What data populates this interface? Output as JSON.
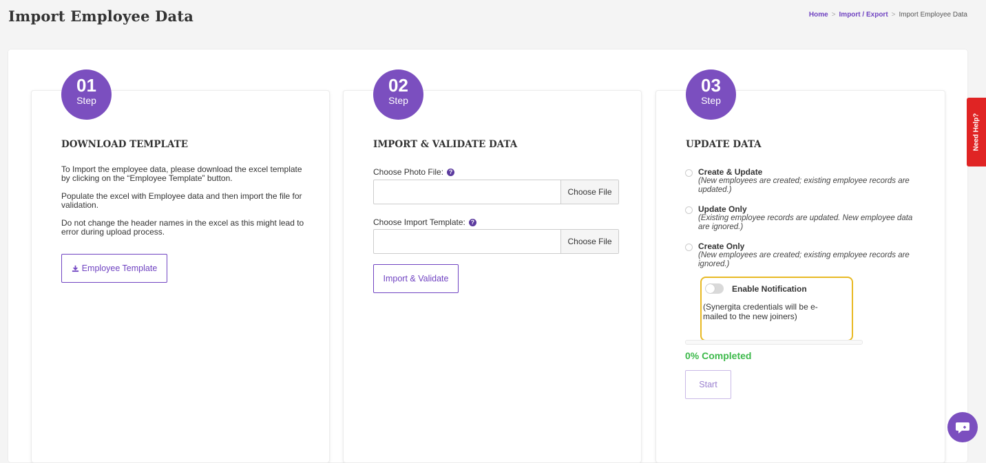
{
  "header": {
    "title": "Import Employee Data",
    "breadcrumb": [
      "Home",
      "Import / Export",
      "Import Employee Data"
    ],
    "breadcrumb_separator": ">"
  },
  "steps": [
    {
      "number": "01",
      "label": "Step",
      "heading": "DOWNLOAD TEMPLATE",
      "paragraphs": [
        "To Import the employee data, please download the excel template by clicking on the “Employee Template” button.",
        "Populate the excel with Employee data and then import the file for validation.",
        "Do not change the header names in the excel as this might lead to error during upload process."
      ],
      "button_label": "Employee Template",
      "button_icon": "download-icon"
    },
    {
      "number": "02",
      "label": "Step",
      "heading": "IMPORT & VALIDATE DATA",
      "photo_label": "Choose Photo File:",
      "template_label": "Choose Import Template:",
      "file_button": "Choose File",
      "help_icon": "question-circle-icon",
      "button_label": "Import & Validate"
    },
    {
      "number": "03",
      "label": "Step",
      "heading": "UPDATE DATA",
      "options": [
        {
          "title": "Create & Update",
          "desc": "(New employees are created; existing employee records are updated.)"
        },
        {
          "title": "Update Only",
          "desc": "(Existing employee records are updated. New employee data are ignored.)"
        },
        {
          "title": "Create Only",
          "desc": "(New employees are created; existing employee records are ignored.)"
        }
      ],
      "notification_label": "Enable Notification",
      "notification_desc": "(Synergita credentials will be e-mailed to the new joiners)",
      "notification_enabled": false,
      "progress_percent": 0,
      "progress_text": "0% Completed",
      "start_label": "Start"
    }
  ],
  "need_help": "Need Help?",
  "colors": {
    "accent": "#7b4fbf",
    "highlight": "#e8b923",
    "success": "#3cb94a",
    "help_tab": "#e02424"
  }
}
